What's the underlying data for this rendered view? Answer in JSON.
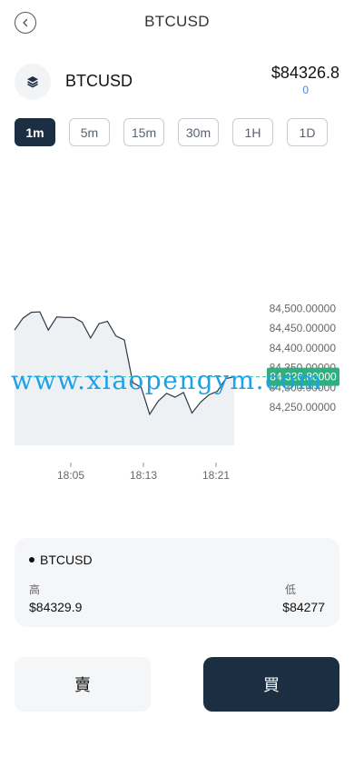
{
  "header": {
    "title": "BTCUSD",
    "back_icon": "chevron-left-icon"
  },
  "symbol": {
    "icon": "layers-icon",
    "name": "BTCUSD",
    "price": "$84326.8",
    "change": "0"
  },
  "intervals": [
    {
      "label": "1m",
      "active": true
    },
    {
      "label": "5m",
      "active": false
    },
    {
      "label": "15m",
      "active": false
    },
    {
      "label": "30m",
      "active": false
    },
    {
      "label": "1H",
      "active": false
    },
    {
      "label": "1D",
      "active": false
    }
  ],
  "chart_data": {
    "type": "line",
    "title": "",
    "xlabel": "",
    "ylabel": "",
    "x_ticks": [
      "18:05",
      "18:13",
      "18:21"
    ],
    "y_ticks": [
      "84,500.00000",
      "84,450.00000",
      "84,400.00000",
      "84,350.00000",
      "84,300.00000",
      "84,250.00000"
    ],
    "y_tick_values": [
      84500,
      84450,
      84400,
      84350,
      84300,
      84250
    ],
    "ylim": [
      84230,
      84530
    ],
    "series": [
      {
        "values": [
          84445,
          84475,
          84490,
          84491,
          84445,
          84478,
          84477,
          84477,
          84465,
          84425,
          84461,
          84467,
          84430,
          84420,
          84312,
          84300,
          84232,
          84265,
          84285,
          84275,
          84287,
          84235,
          84262,
          84281,
          84290,
          84322,
          84327
        ]
      }
    ],
    "current_price_label": "84,326.80000",
    "current_price_value": 84326.8,
    "colors": {
      "line": "#2b3a48",
      "area": "#eef1f4",
      "current_line": "#3cbf98",
      "current_label_bg": "#2db07f"
    },
    "grid": false
  },
  "watermark": "www.xiaopengym.com",
  "info": {
    "title": "BTCUSD",
    "high_label": "高",
    "high_value": "$84329.9",
    "low_label": "低",
    "low_value": "$84277"
  },
  "actions": {
    "sell_label": "賣",
    "buy_label": "買"
  }
}
